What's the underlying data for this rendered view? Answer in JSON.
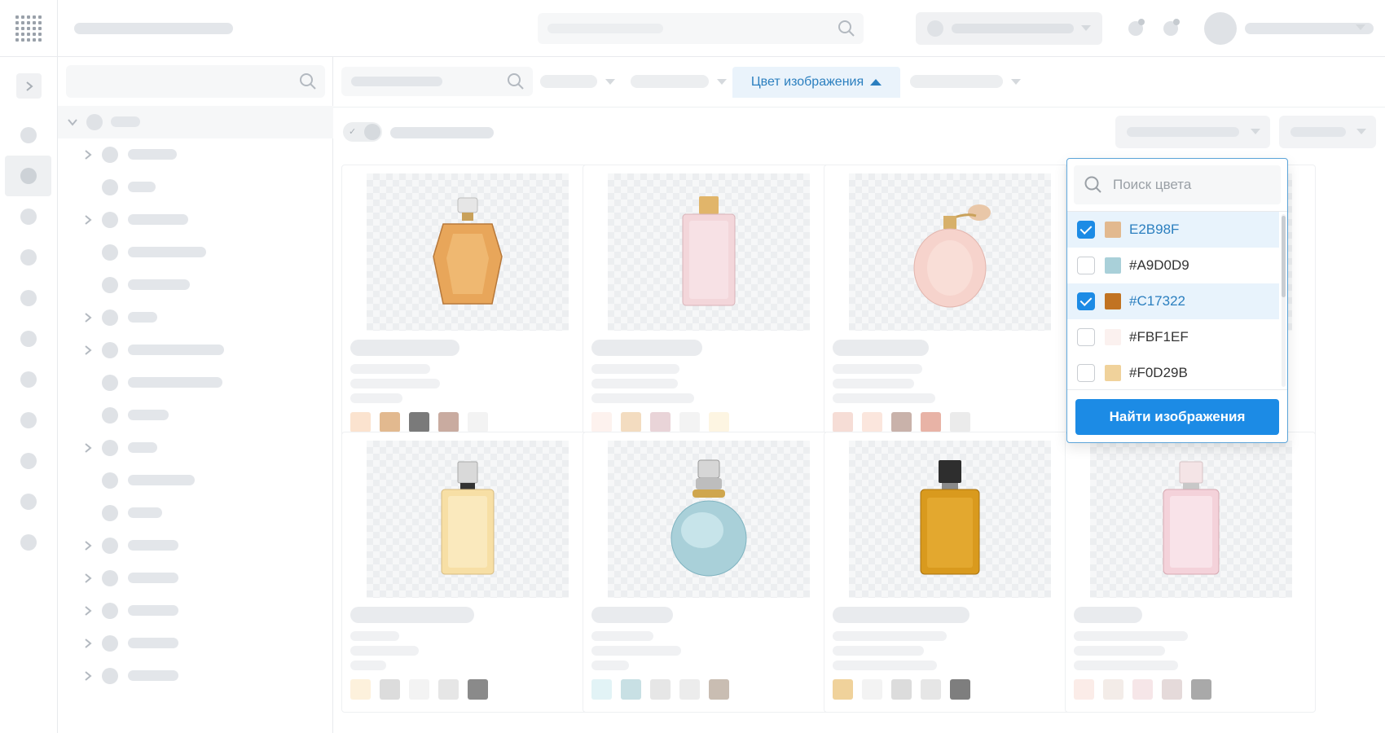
{
  "color_filter": {
    "label": "Цвет изображения"
  },
  "color_dropdown": {
    "search_placeholder": "Поиск цвета",
    "options": [
      {
        "label": "E2B98F",
        "swatch": "#E2B98F",
        "checked": true
      },
      {
        "label": "#A9D0D9",
        "swatch": "#A9D0D9",
        "checked": false
      },
      {
        "label": "#C17322",
        "swatch": "#C17322",
        "checked": true
      },
      {
        "label": "#FBF1EF",
        "swatch": "#FBF1EF",
        "checked": false
      },
      {
        "label": "#F0D29B",
        "swatch": "#F0D29B",
        "checked": false
      }
    ],
    "find_button_label": "Найти изображения"
  },
  "colors": {
    "accent": "#1c8be5",
    "accent_text": "#2b7fbf",
    "skeleton": "#e3e6ea"
  },
  "products": [
    {
      "name": "amber-faceted-perfume",
      "liquid": "#e8a65a",
      "swatches": [
        "#fbe3cf",
        "#e2b98f",
        "#7a7a7a",
        "#c9aba0",
        "#f3f3f3"
      ]
    },
    {
      "name": "pink-tall-perfume",
      "liquid": "#f3d6da",
      "swatches": [
        "#fdf2ee",
        "#f3dcc0",
        "#e9d4d8",
        "#f3f3f3",
        "#fdf5e2"
      ]
    },
    {
      "name": "pink-atomizer-perfume",
      "liquid": "#f6d3cc",
      "swatches": [
        "#f6ddd6",
        "#fbe6dd",
        "#c9b2aa",
        "#e8b3a6",
        "#ebebeb"
      ]
    },
    {
      "name": "orange-black-label-perfume",
      "liquid": "#c17322",
      "swatches": [
        "#c17322",
        "#3b3b3b",
        "#7e7e7e",
        "#f3f3f3",
        "#f3f3f3"
      ]
    },
    {
      "name": "pale-yellow-perfume",
      "liquid": "#f7dfa5",
      "swatches": [
        "#fdf1dc",
        "#dcdcdc",
        "#f3f3f3",
        "#e6e6e6",
        "#8a8a8a"
      ]
    },
    {
      "name": "round-blue-perfume",
      "liquid": "#a9d0d9",
      "swatches": [
        "#e2f3f6",
        "#c8e0e4",
        "#e6e6e6",
        "#ececec",
        "#c9bdb2"
      ]
    },
    {
      "name": "gold-square-perfume",
      "liquid": "#d99a1e",
      "swatches": [
        "#f0d29b",
        "#f3f3f3",
        "#dcdcdc",
        "#e6e6e6",
        "#7e7e7e"
      ]
    },
    {
      "name": "pink-square-perfume",
      "liquid": "#f4d2da",
      "swatches": [
        "#fbece8",
        "#f3ece8",
        "#f6e6e8",
        "#e5dada",
        "#a9a9a9"
      ]
    }
  ]
}
